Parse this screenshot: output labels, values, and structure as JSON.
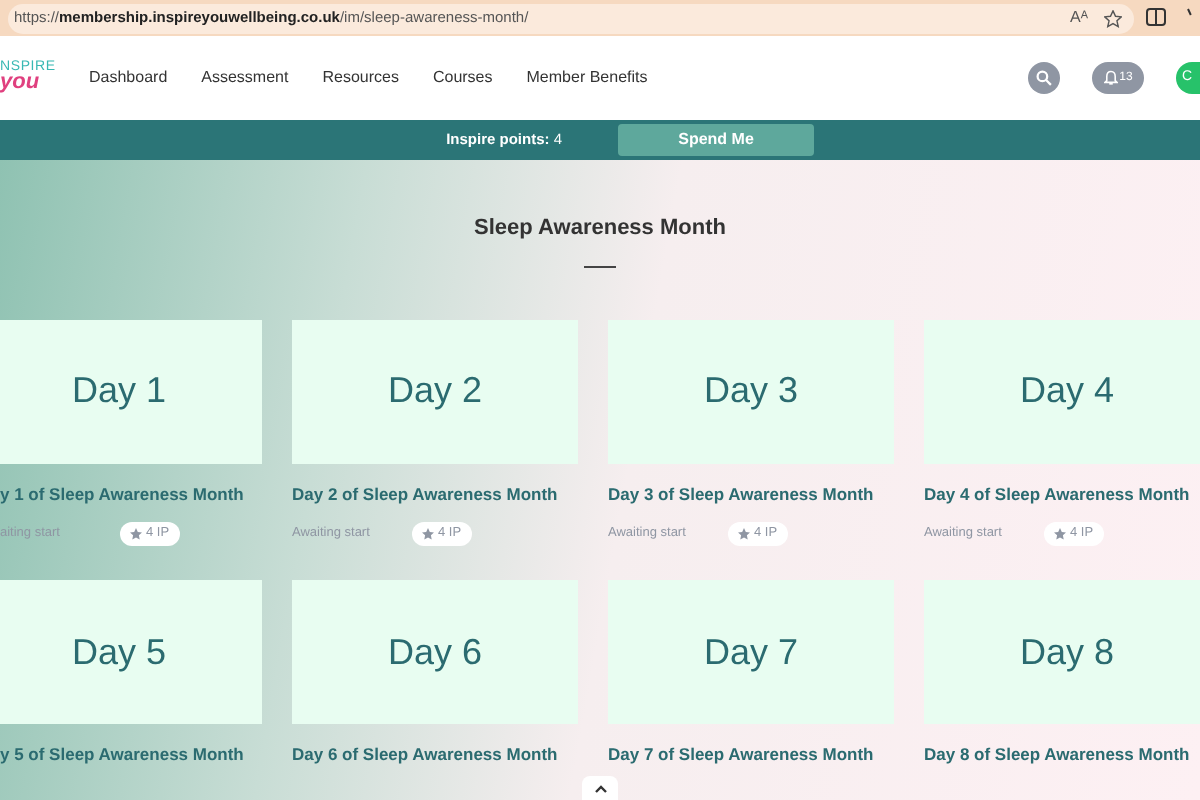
{
  "browser": {
    "url": "https://**membership.inspireyouwellbeing.co.uk**/im/sleep-awareness-month/",
    "read_aloud": "Aᴬ"
  },
  "header": {
    "logo_top": "NSPIRE",
    "logo_bottom": "you",
    "nav": [
      {
        "label": "Dashboard"
      },
      {
        "label": "Assessment"
      },
      {
        "label": "Resources"
      },
      {
        "label": "Courses"
      },
      {
        "label": "Member Benefits"
      }
    ],
    "notifications": "13",
    "avatar": "C"
  },
  "points_bar": {
    "label": "Inspire points:",
    "value": "4",
    "button": "Spend Me"
  },
  "page": {
    "title": "Sleep Awareness Month"
  },
  "cards": [
    {
      "image_text": "Day 1",
      "title": "y 1 of Sleep Awareness Month",
      "status": "aiting start",
      "points": "4 IP"
    },
    {
      "image_text": "Day 2",
      "title": "Day 2 of Sleep Awareness Month",
      "status": "Awaiting start",
      "points": "4 IP"
    },
    {
      "image_text": "Day 3",
      "title": "Day 3 of Sleep Awareness Month",
      "status": "Awaiting start",
      "points": "4 IP"
    },
    {
      "image_text": "Day 4",
      "title": "Day 4 of Sleep Awareness Month",
      "status": "Awaiting start",
      "points": "4 IP"
    },
    {
      "image_text": "Day 5",
      "title": "y 5 of Sleep Awareness Month"
    },
    {
      "image_text": "Day 6",
      "title": "Day 6 of Sleep Awareness Month"
    },
    {
      "image_text": "Day 7",
      "title": "Day 7 of Sleep Awareness Month"
    },
    {
      "image_text": "Day 8",
      "title": "Day 8 of Sleep Awareness Month"
    }
  ]
}
